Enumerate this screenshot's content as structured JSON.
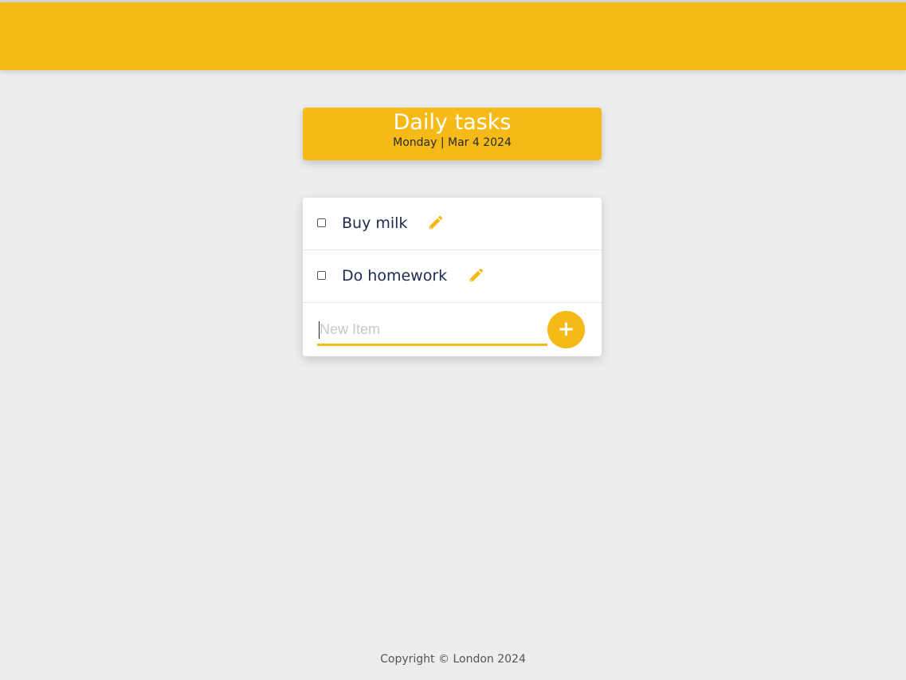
{
  "colors": {
    "accent": "#F5BA18",
    "background": "#EDEDED",
    "item_text": "#1D2A50"
  },
  "heading": {
    "title": "Daily tasks",
    "date": "Monday | Mar 4 2024"
  },
  "items": [
    {
      "label": "Buy milk",
      "checked": false,
      "edit_icon": "pencil-icon"
    },
    {
      "label": "Do homework",
      "checked": false,
      "edit_icon": "pencil-icon"
    }
  ],
  "new_item": {
    "placeholder": "New Item",
    "add_label": "+"
  },
  "footer": {
    "text": "Copyright © London 2024"
  }
}
